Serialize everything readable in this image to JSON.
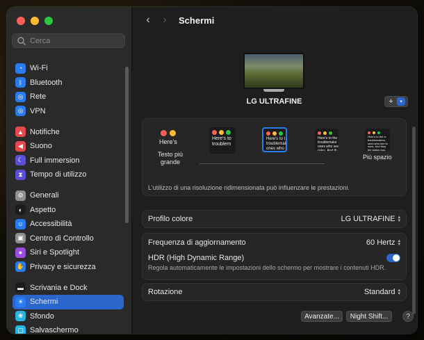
{
  "sidebar": {
    "search_placeholder": "Cerca",
    "groups": [
      [
        {
          "label": "Wi-Fi",
          "icon": "wifi-icon",
          "color": "#2a7bf0"
        },
        {
          "label": "Bluetooth",
          "icon": "bluetooth-icon",
          "color": "#2a7bf0"
        },
        {
          "label": "Rete",
          "icon": "globe-icon",
          "color": "#2a7bf0"
        },
        {
          "label": "VPN",
          "icon": "vpn-globe-icon",
          "color": "#2a7bf0"
        }
      ],
      [
        {
          "label": "Notifiche",
          "icon": "bell-icon",
          "color": "#e5484d"
        },
        {
          "label": "Suono",
          "icon": "speaker-icon",
          "color": "#e5484d"
        },
        {
          "label": "Full immersion",
          "icon": "moon-icon",
          "color": "#5b4fd6"
        },
        {
          "label": "Tempo di utilizzo",
          "icon": "hourglass-icon",
          "color": "#5b4fd6"
        }
      ],
      [
        {
          "label": "Generali",
          "icon": "gear-icon",
          "color": "#8e8e93"
        },
        {
          "label": "Aspetto",
          "icon": "appearance-icon",
          "color": "#1c1c1c"
        },
        {
          "label": "Accessibilità",
          "icon": "accessibility-icon",
          "color": "#2a7bf0"
        },
        {
          "label": "Centro di Controllo",
          "icon": "control-center-icon",
          "color": "#8e8e93"
        },
        {
          "label": "Siri e Spotlight",
          "icon": "siri-icon",
          "color": "#9b4de0"
        },
        {
          "label": "Privacy e sicurezza",
          "icon": "hand-icon",
          "color": "#2a7bf0"
        }
      ],
      [
        {
          "label": "Scrivania e Dock",
          "icon": "dock-icon",
          "color": "#1c1c1c"
        },
        {
          "label": "Schermi",
          "icon": "sun-icon",
          "color": "#2a7bf0",
          "active": true
        },
        {
          "label": "Sfondo",
          "icon": "flower-icon",
          "color": "#2ab5e0"
        },
        {
          "label": "Salvaschermo",
          "icon": "screensaver-icon",
          "color": "#2ab5e0"
        }
      ]
    ]
  },
  "main": {
    "title": "Schermi",
    "display_name": "LG ULTRAFINE",
    "add_button": "+",
    "resolution": {
      "options": [
        {
          "label": "Testo più\ngrande",
          "preview": "Here's"
        },
        {
          "label": "",
          "preview": "Here's to\ntroublem"
        },
        {
          "label": "",
          "preview": "Here's to t\ntroublemak\nones who s"
        },
        {
          "label": "",
          "preview": "Here's to the\ntroublemake\nones who see\nrules. And th"
        },
        {
          "label": "Più spazio",
          "preview": "Here's to the cr\ntroublemakers.\nones who see th\nrules. And they\nthe status quo."
        }
      ],
      "note": "L'utilizzo di una risoluzione ridimensionata può influenzare le prestazioni."
    },
    "color_profile": {
      "label": "Profilo colore",
      "value": "LG ULTRAFINE"
    },
    "refresh_rate": {
      "label": "Frequenza di aggiornamento",
      "value": "60 Hertz"
    },
    "hdr": {
      "label": "HDR (High Dynamic Range)",
      "description": "Regola automaticamente le impostazioni dello schermo per mostrare i contenuti HDR.",
      "enabled": true
    },
    "rotation": {
      "label": "Rotazione",
      "value": "Standard"
    },
    "buttons": {
      "advanced": "Avanzate...",
      "night_shift": "Night Shift...",
      "help": "?"
    }
  }
}
